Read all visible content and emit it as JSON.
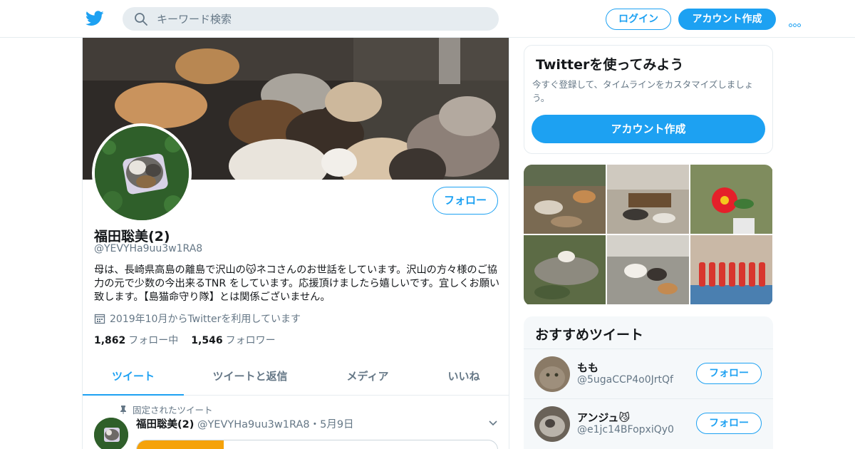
{
  "nav": {
    "search_placeholder": "キーワード検索",
    "login": "ログイン",
    "signup": "アカウント作成"
  },
  "profile": {
    "name": "福田聡美(2)",
    "handle": "@YEVYHa9uu3w1RA8",
    "follow_button": "フォロー",
    "bio": "母は、長崎県高島の離島で沢山の😽ネコさんのお世話をしています。沢山の方々様のご協力の元で少数の今出来るTNR をしています。応援頂けましたら嬉しいです。宜しくお願い致します。【島猫命守り隊】とは関係ございません。",
    "joined": "2019年10月からTwitterを利用しています",
    "following_count": "1,862",
    "following_label": "フォロー中",
    "followers_count": "1,546",
    "followers_label": "フォロワー"
  },
  "tabs": [
    "ツイート",
    "ツイートと返信",
    "メディア",
    "いいね"
  ],
  "pinned_tweet": {
    "pinned_label": "固定されたツイート",
    "name": "福田聡美(2)",
    "handle": "@YEVYHa9uu3w1RA8",
    "separator": "・",
    "date": "5月9日"
  },
  "signup_card": {
    "title": "Twitterを使ってみよう",
    "description": "今すぐ登録して、タイムラインをカスタマイズしましょう。",
    "button": "アカウント作成"
  },
  "recommended": {
    "title": "おすすめツイート",
    "follow_label": "フォロー",
    "users": [
      {
        "name": "もも",
        "handle": "@5ugaCCP4o0JrtQf"
      },
      {
        "name": "アンジュ😼",
        "handle": "@e1jc14BFopxiQy0"
      }
    ]
  },
  "colors": {
    "accent": "#1da1f2",
    "text": "#14171a",
    "muted": "#657786",
    "border": "#e6ecf0"
  }
}
